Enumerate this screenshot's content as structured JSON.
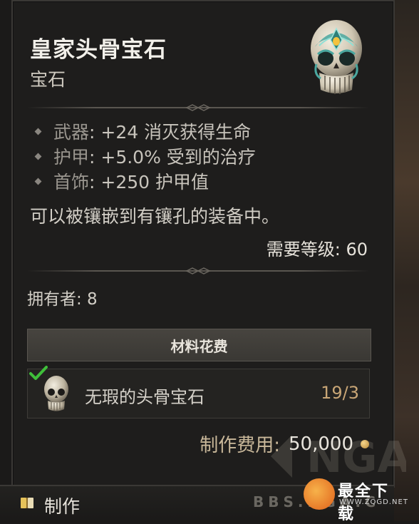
{
  "item": {
    "name": "皇家头骨宝石",
    "type": "宝石",
    "affixes": [
      {
        "slot": "武器",
        "value": ": +24 消灭获得生命"
      },
      {
        "slot": "护甲",
        "value": ": +5.0% 受到的治疗"
      },
      {
        "slot": "首饰",
        "value": ": +250 护甲值"
      }
    ],
    "socket_text": "可以被镶嵌到有镶孔的装备中。",
    "required_level": "需要等级: 60",
    "owned": "拥有者: 8"
  },
  "materials": {
    "header": "材料花费",
    "rows": [
      {
        "name": "无瑕的头骨宝石",
        "count": "19/3"
      }
    ]
  },
  "cost": {
    "label": "制作费用:",
    "value": "50,000"
  },
  "footer": {
    "craft_label": "制作",
    "watermark": "BBS.NGA.C"
  },
  "site_logo": {
    "title": "最全下载",
    "subtitle": "WWW.ZQGD.NET"
  },
  "colors": {
    "panel_bg": "#1e1d1c",
    "gem_teal": "#57b6ad",
    "gem_gold": "#e9b43c",
    "count_color": "#c9a676",
    "check_green": "#3fbf3a"
  }
}
